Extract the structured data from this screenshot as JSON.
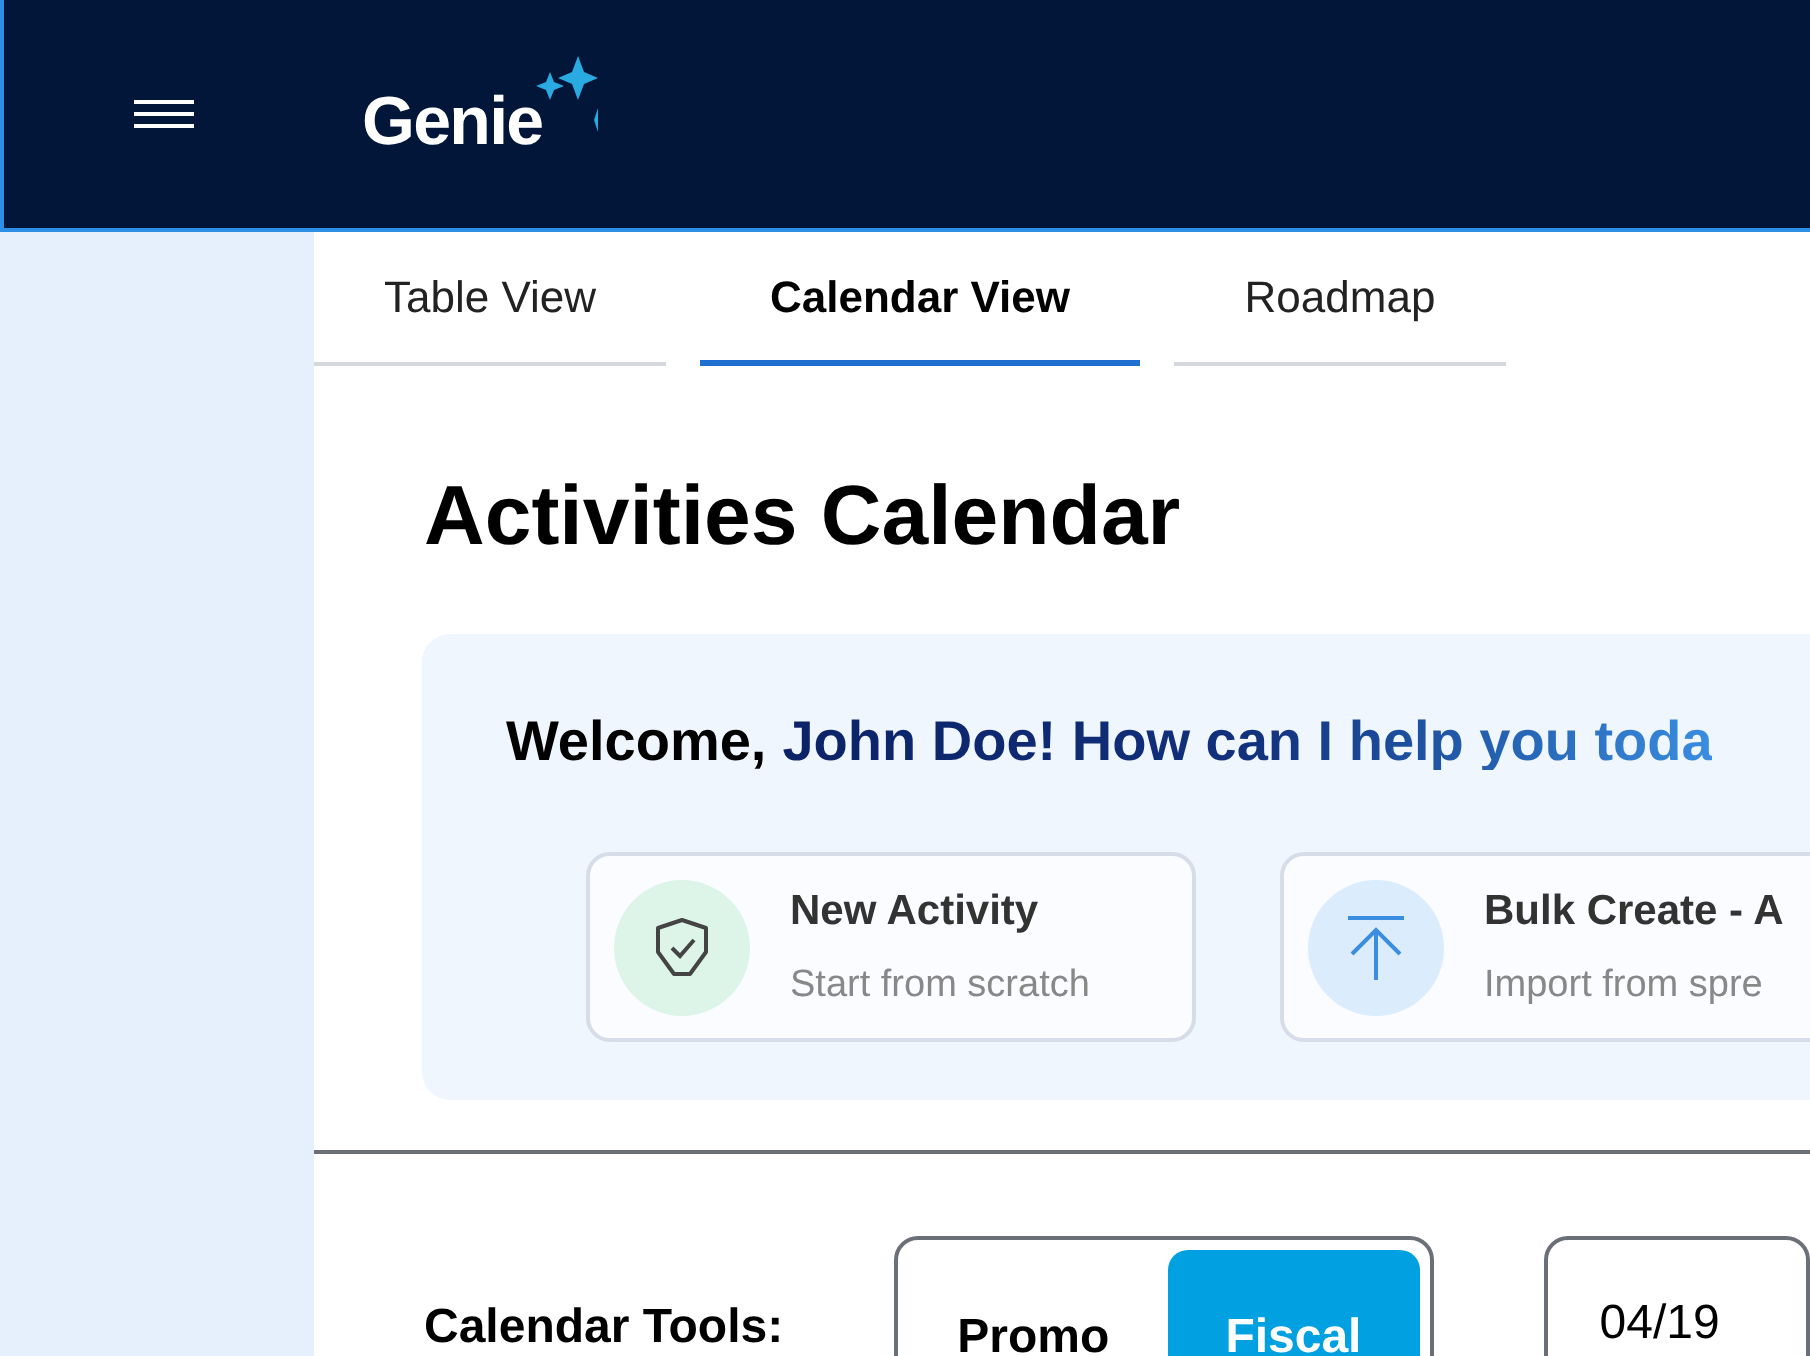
{
  "header": {
    "logo": "Genie"
  },
  "tabs": [
    {
      "label": "Table View",
      "selected": false
    },
    {
      "label": "Calendar View",
      "selected": true
    },
    {
      "label": "Roadmap",
      "selected": false
    }
  ],
  "title": "Activities Calendar",
  "welcome": {
    "greeting": "Welcome,",
    "message": "John Doe! How can I help you toda"
  },
  "actions": [
    {
      "kind": "new",
      "title": "New Activity",
      "subtitle": "Start from scratch"
    },
    {
      "kind": "import",
      "title": "Bulk Create - A",
      "subtitle": "Import from spre"
    }
  ],
  "calendar_tools": {
    "label": "Calendar Tools:",
    "options": [
      {
        "label": "Promo",
        "selected": false
      },
      {
        "label": "Fiscal",
        "selected": true
      }
    ],
    "date": "04/19"
  }
}
